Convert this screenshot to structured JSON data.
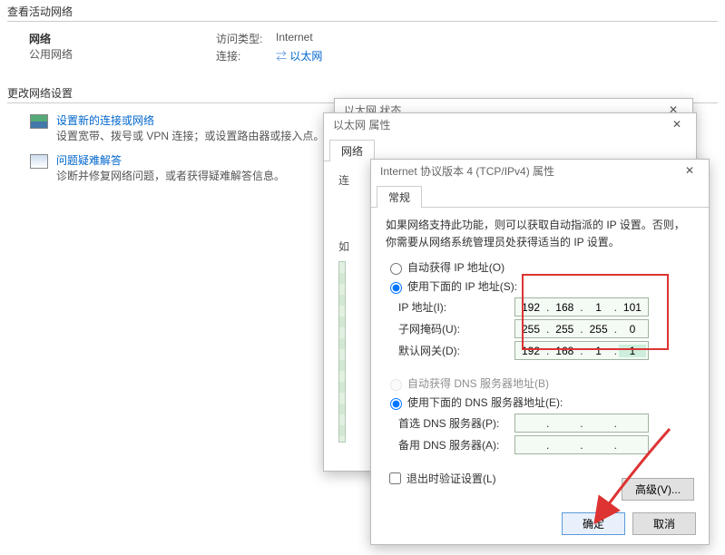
{
  "sections": {
    "active": "查看活动网络",
    "change": "更改网络设置"
  },
  "network": {
    "title": "网络",
    "subtitle": "公用网络",
    "access_label": "访问类型:",
    "access_value": "Internet",
    "conn_label": "连接:",
    "conn_value": "以太网"
  },
  "change_items": {
    "adapter": {
      "title": "设置新的连接或网络",
      "desc": "设置宽带、拨号或 VPN 连接；或设置路由器或接入点。"
    },
    "trouble": {
      "title": "问题疑难解答",
      "desc": "诊断并修复网络问题，或者获得疑难解答信息。"
    }
  },
  "bg_dialogs": {
    "status_title": "以太网 状态",
    "props_title": "以太网 属性",
    "tab_network": "网络",
    "conn_word": "连",
    "conn_desc": "如"
  },
  "ipv4": {
    "title": "Internet 协议版本 4 (TCP/IPv4) 属性",
    "tab": "常规",
    "desc": "如果网络支持此功能，则可以获取自动指派的 IP 设置。否则，你需要从网络系统管理员处获得适当的 IP 设置。",
    "radio_auto_ip": "自动获得 IP 地址(O)",
    "radio_manual_ip": "使用下面的 IP 地址(S):",
    "lbl_ip": "IP 地址(I):",
    "lbl_mask": "子网掩码(U):",
    "lbl_gw": "默认网关(D):",
    "ip": [
      "192",
      "168",
      "1",
      "101"
    ],
    "mask": [
      "255",
      "255",
      "255",
      "0"
    ],
    "gw": [
      "192",
      "168",
      "1",
      "1"
    ],
    "radio_auto_dns": "自动获得 DNS 服务器地址(B)",
    "radio_manual_dns": "使用下面的 DNS 服务器地址(E):",
    "lbl_dns1": "首选 DNS 服务器(P):",
    "lbl_dns2": "备用 DNS 服务器(A):",
    "chk_validate": "退出时验证设置(L)",
    "btn_adv": "高级(V)...",
    "btn_ok": "确定",
    "btn_cancel": "取消"
  }
}
